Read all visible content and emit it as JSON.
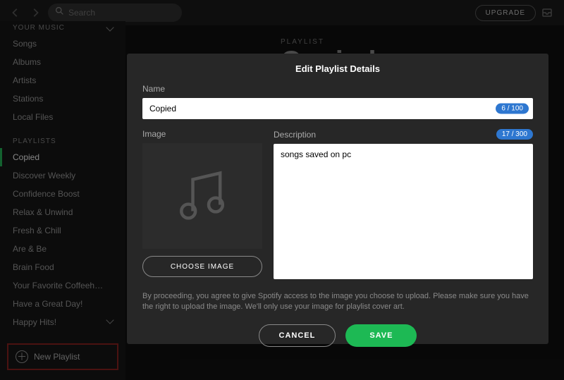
{
  "topbar": {
    "search_placeholder": "Search",
    "upgrade_label": "UPGRADE"
  },
  "sidebar": {
    "section_music": "YOUR MUSIC",
    "music_items": [
      "Songs",
      "Albums",
      "Artists",
      "Stations",
      "Local Files"
    ],
    "section_playlists": "PLAYLISTS",
    "playlist_items": [
      "Copied",
      "Discover Weekly",
      "Confidence Boost",
      "Relax & Unwind",
      "Fresh & Chill",
      "Are & Be",
      "Brain Food",
      "Your Favorite Coffeeh…",
      "Have a Great Day!",
      "Happy Hits!"
    ],
    "active_playlist_index": 0,
    "new_playlist_label": "New Playlist"
  },
  "main": {
    "header_label": "PLAYLIST",
    "title": "Copied"
  },
  "modal": {
    "title": "Edit Playlist Details",
    "name_label": "Name",
    "name_value": "Copied",
    "name_counter": "6 / 100",
    "image_label": "Image",
    "choose_image_label": "CHOOSE IMAGE",
    "description_label": "Description",
    "description_value": "songs saved on pc",
    "description_counter": "17 / 300",
    "disclaimer": "By proceeding, you agree to give Spotify access to the image you choose to upload. Please make sure you have the right to upload the image. We'll only use your image for playlist cover art.",
    "cancel_label": "CANCEL",
    "save_label": "SAVE"
  }
}
